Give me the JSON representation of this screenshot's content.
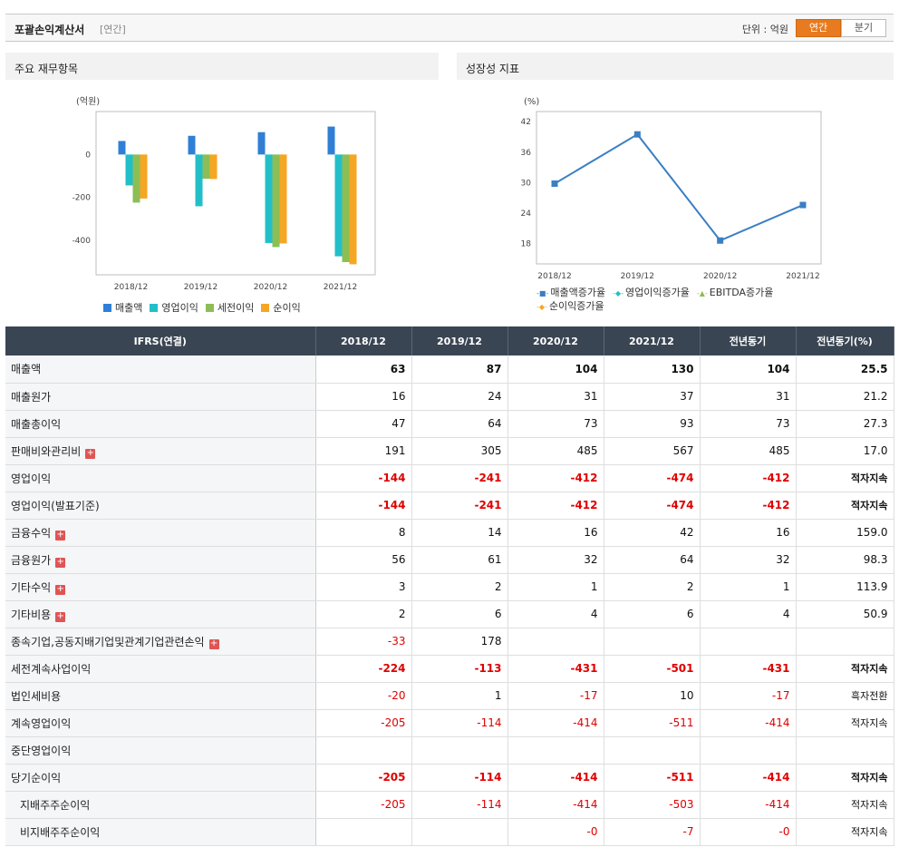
{
  "header": {
    "title": "포괄손익계산서",
    "subtitle": "[연간]",
    "unit": "단위 : 억원",
    "tab_on": "연간",
    "tab_off": "분기"
  },
  "panel1": {
    "title": "주요 재무항목"
  },
  "panel2": {
    "title": "성장성 지표"
  },
  "colors": {
    "sales": "#2f7fd6",
    "op": "#22bfc9",
    "pre": "#8dbe55",
    "net": "#f5a623",
    "line": "#3a7fc4"
  },
  "chart_data": [
    {
      "type": "bar",
      "ylabel": "(억원)",
      "categories": [
        "2018/12",
        "2019/12",
        "2020/12",
        "2021/12"
      ],
      "ylim": [
        -560,
        200
      ],
      "yticks": [
        0,
        -200,
        -400
      ],
      "series": [
        {
          "name": "매출액",
          "values": [
            63,
            87,
            104,
            130
          ]
        },
        {
          "name": "영업이익",
          "values": [
            -144,
            -241,
            -412,
            -474
          ]
        },
        {
          "name": "세전이익",
          "values": [
            -224,
            -113,
            -431,
            -501
          ]
        },
        {
          "name": "순이익",
          "values": [
            -205,
            -114,
            -414,
            -511
          ]
        }
      ]
    },
    {
      "type": "line",
      "ylabel": "(%)",
      "categories": [
        "2018/12",
        "2019/12",
        "2020/12",
        "2021/12"
      ],
      "ylim": [
        14,
        44
      ],
      "yticks": [
        42,
        36,
        30,
        24,
        18
      ],
      "series": [
        {
          "name": "매출액증가율",
          "values": [
            29.8,
            39.5,
            18.6,
            25.6
          ]
        }
      ],
      "legend": [
        "매출액증가율",
        "영업이익증가율",
        "EBITDA증가율",
        "순이익증가율"
      ]
    }
  ],
  "table": {
    "headers": [
      "IFRS(연결)",
      "2018/12",
      "2019/12",
      "2020/12",
      "2021/12",
      "전년동기",
      "전년동기(%)"
    ],
    "rows": [
      {
        "label": "매출액",
        "values": [
          "63",
          "87",
          "104",
          "130",
          "104",
          "25.5"
        ],
        "bold": true,
        "sec": false,
        "neg": false,
        "plus": false,
        "ind": false
      },
      {
        "label": "매출원가",
        "values": [
          "16",
          "24",
          "31",
          "37",
          "31",
          "21.2"
        ],
        "bold": false,
        "sec": false,
        "neg": false,
        "plus": false,
        "ind": false
      },
      {
        "label": "매출총이익",
        "values": [
          "47",
          "64",
          "73",
          "93",
          "73",
          "27.3"
        ],
        "bold": false,
        "sec": false,
        "neg": false,
        "plus": false,
        "ind": false
      },
      {
        "label": "판매비와관리비",
        "values": [
          "191",
          "305",
          "485",
          "567",
          "485",
          "17.0"
        ],
        "bold": false,
        "sec": false,
        "neg": false,
        "plus": true,
        "ind": false
      },
      {
        "label": "영업이익",
        "values": [
          "-144",
          "-241",
          "-412",
          "-474",
          "-412",
          "적자지속"
        ],
        "bold": true,
        "sec": true,
        "neg": true,
        "plus": false,
        "ind": false
      },
      {
        "label": "영업이익(발표기준)",
        "values": [
          "-144",
          "-241",
          "-412",
          "-474",
          "-412",
          "적자지속"
        ],
        "bold": true,
        "sec": false,
        "neg": true,
        "plus": false,
        "ind": false
      },
      {
        "label": "금융수익",
        "values": [
          "8",
          "14",
          "16",
          "42",
          "16",
          "159.0"
        ],
        "bold": false,
        "sec": true,
        "neg": false,
        "plus": true,
        "ind": false
      },
      {
        "label": "금융원가",
        "values": [
          "56",
          "61",
          "32",
          "64",
          "32",
          "98.3"
        ],
        "bold": false,
        "sec": false,
        "neg": false,
        "plus": true,
        "ind": false
      },
      {
        "label": "기타수익",
        "values": [
          "3",
          "2",
          "1",
          "2",
          "1",
          "113.9"
        ],
        "bold": false,
        "sec": false,
        "neg": false,
        "plus": true,
        "ind": false
      },
      {
        "label": "기타비용",
        "values": [
          "2",
          "6",
          "4",
          "6",
          "4",
          "50.9"
        ],
        "bold": false,
        "sec": false,
        "neg": false,
        "plus": true,
        "ind": false
      },
      {
        "label": "종속기업,공동지배기업및관계기업관련손익",
        "values": [
          "-33",
          "178",
          "",
          "",
          "",
          ""
        ],
        "bold": false,
        "sec": false,
        "neg": false,
        "plus": true,
        "ind": false
      },
      {
        "label": "세전계속사업이익",
        "values": [
          "-224",
          "-113",
          "-431",
          "-501",
          "-431",
          "적자지속"
        ],
        "bold": true,
        "sec": true,
        "neg": true,
        "plus": false,
        "ind": false
      },
      {
        "label": "법인세비용",
        "values": [
          "-20",
          "1",
          "-17",
          "10",
          "-17",
          "흑자전환"
        ],
        "bold": false,
        "sec": false,
        "neg": false,
        "plus": false,
        "ind": false
      },
      {
        "label": "계속영업이익",
        "values": [
          "-205",
          "-114",
          "-414",
          "-511",
          "-414",
          "적자지속"
        ],
        "bold": false,
        "sec": false,
        "neg": false,
        "plus": false,
        "ind": false
      },
      {
        "label": "중단영업이익",
        "values": [
          "",
          "",
          "",
          "",
          "",
          ""
        ],
        "bold": false,
        "sec": false,
        "neg": false,
        "plus": false,
        "ind": false
      },
      {
        "label": "당기순이익",
        "values": [
          "-205",
          "-114",
          "-414",
          "-511",
          "-414",
          "적자지속"
        ],
        "bold": true,
        "sec": true,
        "neg": true,
        "plus": false,
        "ind": false
      },
      {
        "label": "지배주주순이익",
        "values": [
          "-205",
          "-114",
          "-414",
          "-503",
          "-414",
          "적자지속"
        ],
        "bold": false,
        "sec": false,
        "neg": false,
        "plus": false,
        "ind": true
      },
      {
        "label": "비지배주주순이익",
        "values": [
          "",
          "",
          "-0",
          "-7",
          "-0",
          "적자지속"
        ],
        "bold": false,
        "sec": false,
        "neg": false,
        "plus": false,
        "ind": true
      }
    ]
  }
}
